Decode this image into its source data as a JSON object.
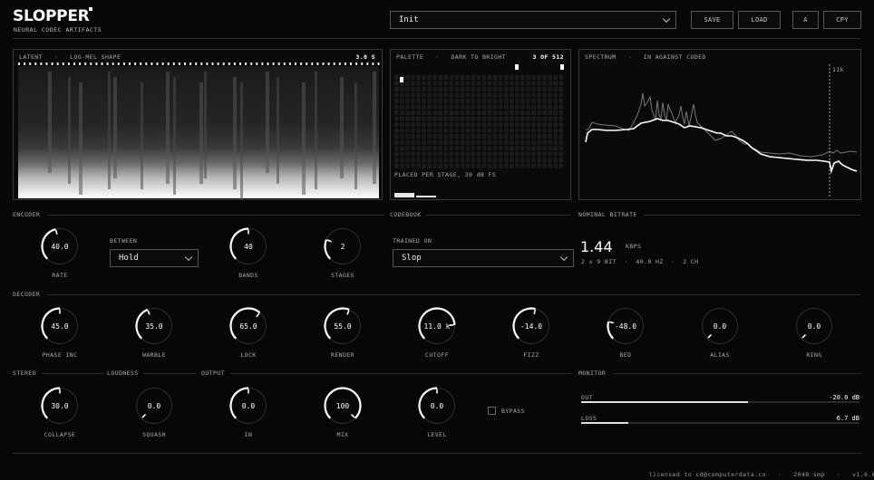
{
  "header": {
    "title": "SLOPPER",
    "subtitle": "NEURAL CODEC ARTIFACTS",
    "preset": "Init",
    "buttons": [
      "SAVE",
      "LOAD",
      "A",
      "CPY"
    ]
  },
  "latent_panel": {
    "label": "LATENT",
    "sep": "·",
    "mode": "LOG-MEL SHAPE",
    "duration": "3.0 S"
  },
  "palette_panel": {
    "label": "PALETTE",
    "sep": "·",
    "mode": "DARK TO BRIGHT",
    "count": "3 OF 512",
    "footer": "PLACED PER STAGE, 30 dB FS"
  },
  "spectrum_panel": {
    "label": "SPECTRUM",
    "sep": "·",
    "mode": "IN AGAINST CODED",
    "marker": "11k"
  },
  "sections": {
    "encoder": "ENCODER",
    "codebook": "CODEBOOK",
    "nominal_bitrate": "NOMINAL BITRATE",
    "decoder": "DECODER",
    "stereo": "STEREO",
    "loudness": "LOUDNESS",
    "output": "OUTPUT",
    "monitor": "MONITOR"
  },
  "encoder": {
    "rate": {
      "label": "RATE",
      "value": "40.0",
      "level": 0.45
    },
    "between_label": "BETWEEN",
    "between_value": "Hold",
    "bands": {
      "label": "BANDS",
      "value": "40",
      "level": 0.5
    },
    "stages": {
      "label": "STAGES",
      "value": "2",
      "level": 0.25
    }
  },
  "codebook": {
    "trained_on_label": "TRAINED ON",
    "trained_on_value": "Slop"
  },
  "bitrate": {
    "value": "1.44",
    "unit": "KBPS",
    "details": "2 x 9 BIT  ·  40.0 HZ  ·  2 CH"
  },
  "decoder": [
    {
      "label": "PHASE INC",
      "value": "45.0",
      "level": 0.5
    },
    {
      "label": "WARBLE",
      "value": "35.0",
      "level": 0.42
    },
    {
      "label": "LOCK",
      "value": "65.0",
      "level": 0.65
    },
    {
      "label": "RENDER",
      "value": "55.0",
      "level": 0.58
    },
    {
      "label": "CUTOFF",
      "value": "11.0 k",
      "level": 0.82
    },
    {
      "label": "FIZZ",
      "value": "-14.0",
      "level": 0.55
    },
    {
      "label": "BED",
      "value": "-48.0",
      "level": 0.22
    },
    {
      "label": "ALIAS",
      "value": "0.0",
      "level": 0.0
    },
    {
      "label": "RING",
      "value": "0.0",
      "level": 0.0
    }
  ],
  "bottom_knobs": [
    {
      "label": "COLLAPSE",
      "value": "30.0",
      "level": 0.5
    },
    {
      "label": "SQUASH",
      "value": "0.0",
      "level": 0.0
    },
    {
      "label": "IN",
      "value": "0.0",
      "level": 0.5
    },
    {
      "label": "MIX",
      "value": "100",
      "level": 1.0
    },
    {
      "label": "LEVEL",
      "value": "0.0",
      "level": 0.5
    }
  ],
  "bypass": {
    "label": "BYPASS",
    "checked": false
  },
  "monitor": {
    "out": {
      "label": "OUT",
      "value": "-20.0 dB",
      "fill": 0.6
    },
    "loss": {
      "label": "LOSS",
      "value": "6.7 dB",
      "fill": 0.17
    }
  },
  "footer": {
    "license": "licensed to cd@computerdata.co",
    "sep": "·",
    "buffer": "2048 smp",
    "version": "v1.6.0"
  },
  "colors": {
    "background": "#070707",
    "accent": "#ffffff",
    "border": "#3a3a3a"
  }
}
